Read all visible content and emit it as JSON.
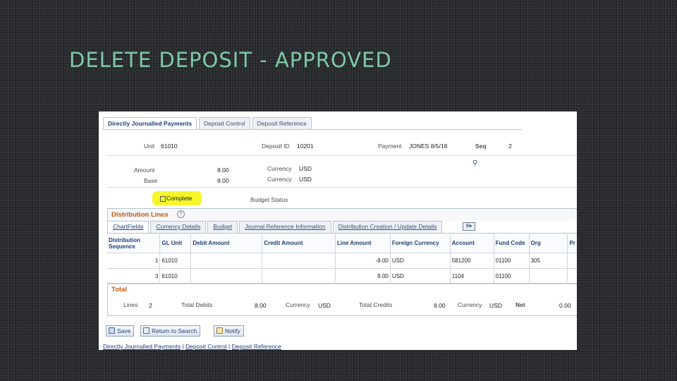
{
  "slide": {
    "title": "DELETE DEPOSIT - APPROVED"
  },
  "tabs": [
    "Directly Journalled Payments",
    "Deposit Control",
    "Deposit Reference"
  ],
  "header": {
    "unit_label": "Unit",
    "unit_value": "61010",
    "deposit_label": "Deposit ID",
    "deposit_value": "10201",
    "payment_label": "Payment",
    "payment_value": "JONES 8/5/18",
    "seq_label": "Seq",
    "seq_value": "2",
    "amount_label": "Amount",
    "amount_value": "8.00",
    "base_label": "Base",
    "base_value": "8.00",
    "currency_label": "Currency",
    "currency_value": "USD",
    "currency2_label": "Currency",
    "currency2_value": "USD",
    "complete_label": "Complete",
    "budget_label": "Budget Status"
  },
  "distribution": {
    "title": "Distribution Lines",
    "help": "?",
    "subtabs": [
      "ChartFields",
      "Currency Details",
      "Budget",
      "Journal Reference Information",
      "Distribution Creation / Update Details"
    ],
    "scroll_icon": "⊞▸",
    "columns": [
      "Distribution Sequence",
      "GL Unit",
      "Debit Amount",
      "Credit Amount",
      "Line Amount",
      "Foreign Currency",
      "Account",
      "Fund Code",
      "Org",
      "Pr"
    ],
    "rows": [
      {
        "seq": "1",
        "gl_unit": "61010",
        "debit": "",
        "credit": "",
        "line": "-8.00",
        "currency": "USD",
        "account": "581200",
        "fund": "01100",
        "org": "305"
      },
      {
        "seq": "3",
        "gl_unit": "61010",
        "debit": "",
        "credit": "",
        "line": "8.00",
        "currency": "USD",
        "account": "1104",
        "fund": "01100",
        "org": ""
      }
    ]
  },
  "total": {
    "title": "Total",
    "lines_label": "Lines",
    "lines_value": "2",
    "debits_label": "Total Debits",
    "debits_value": "8.00",
    "currency_label": "Currency",
    "currency_value": "USD",
    "credits_label": "Total Credits",
    "credits_value": "8.00",
    "currency2_label": "Currency",
    "currency2_value": "USD",
    "net_label": "Net",
    "net_value": "0.00"
  },
  "buttons": {
    "save": "Save",
    "return": "Return to Search",
    "notify": "Notify"
  },
  "footer": {
    "link1": "Directly Journalled Payments",
    "sep": " | ",
    "link2": "Deposit Control",
    "link3": "Deposit Reference"
  },
  "colors": {
    "title": "#7ec8a8",
    "highlight": "#f5f52a",
    "section": "#c25a10",
    "link": "#1f3f77"
  }
}
